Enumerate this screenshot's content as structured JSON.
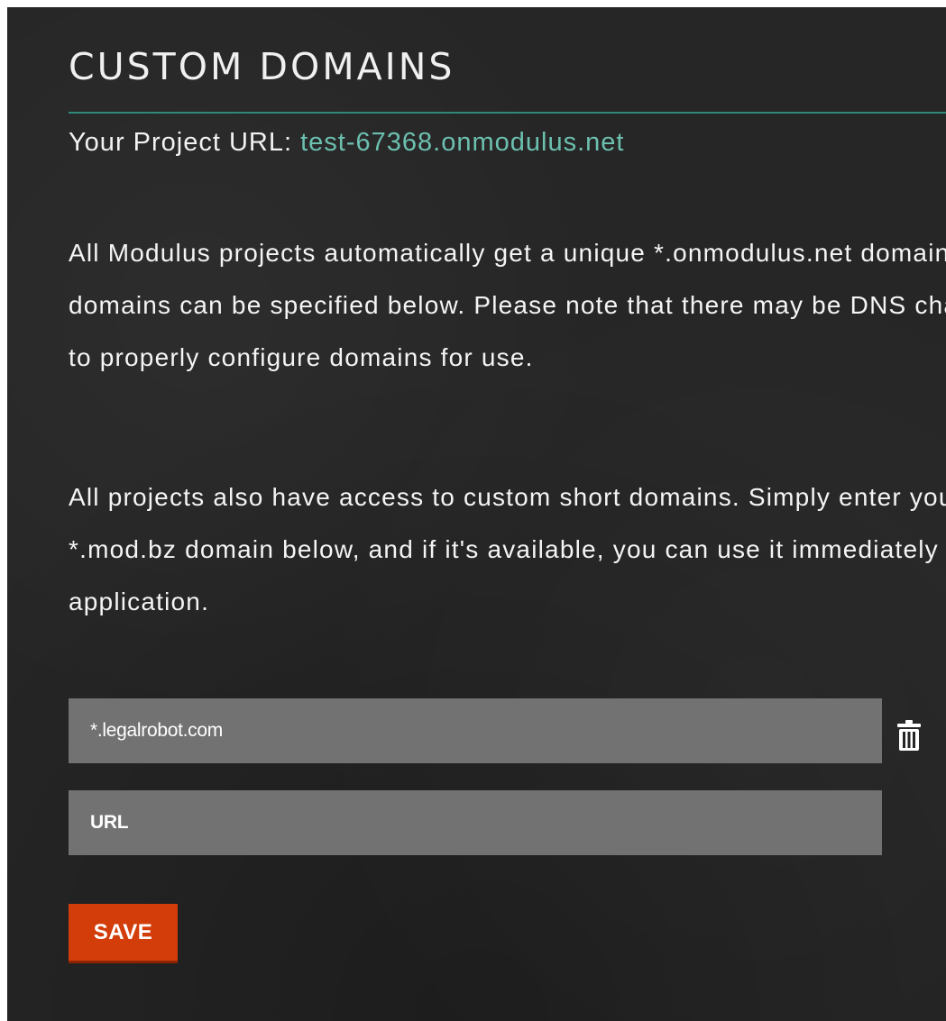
{
  "header": {
    "title": "CUSTOM DOMAINS"
  },
  "project": {
    "label": "Your Project URL: ",
    "url": "test-67368.onmodulus.net"
  },
  "description": {
    "paragraph1": [
      "All Modulus projects automatically get a unique *.onmodulus.net domain. Additional",
      "domains can be specified below. Please note that there may be DNS changes needed",
      "to properly configure domains for use."
    ],
    "paragraph2": [
      "All projects also have access to custom short domains. Simply enter your desired",
      "*.mod.bz domain below, and if it's available, you can use it immediately for your",
      "application."
    ]
  },
  "domains": {
    "existing_value": "*.legalrobot.com",
    "new_placeholder": "URL"
  },
  "actions": {
    "save_label": "SAVE"
  },
  "icons": {
    "delete": "trash-icon"
  },
  "colors": {
    "accent": "#6cc0b0",
    "rule": "#2f8a79",
    "save": "#d33d0a",
    "input_bg": "#727272",
    "background": "#262626"
  }
}
